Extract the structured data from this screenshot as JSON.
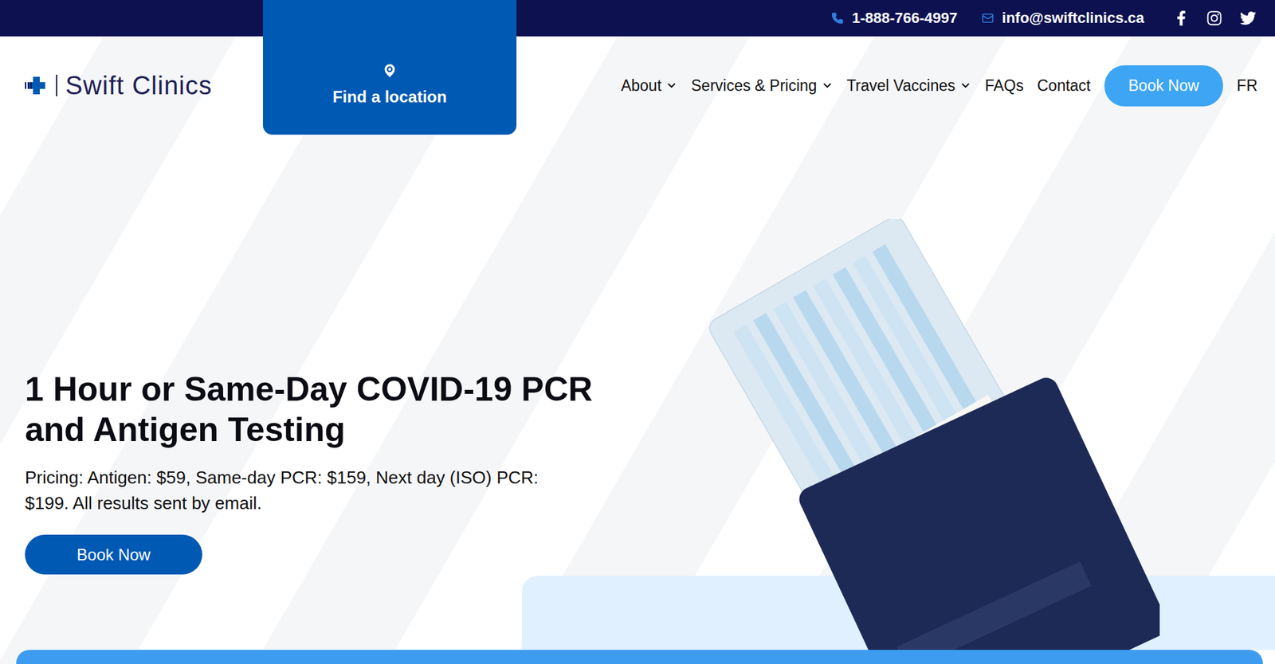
{
  "top_bar": {
    "phone": "1-888-766-4997",
    "email": "info@swiftclinics.ca"
  },
  "logo": {
    "text": "Swift Clinics"
  },
  "locator": {
    "label": "Find a location"
  },
  "nav": {
    "items": [
      {
        "label": "About",
        "has_menu": true
      },
      {
        "label": "Services & Pricing",
        "has_menu": true
      },
      {
        "label": "Travel Vaccines",
        "has_menu": true
      },
      {
        "label": "FAQs",
        "has_menu": false
      },
      {
        "label": "Contact",
        "has_menu": false
      }
    ],
    "cta": "Book Now",
    "language": "FR"
  },
  "hero": {
    "title": "1 Hour or Same-Day COVID-19 PCR and Antigen Testing",
    "subtitle": "Pricing: Antigen: $59, Same-day PCR: $159, Next day (ISO) PCR: $199. All results sent by email.",
    "button": "Book Now"
  }
}
